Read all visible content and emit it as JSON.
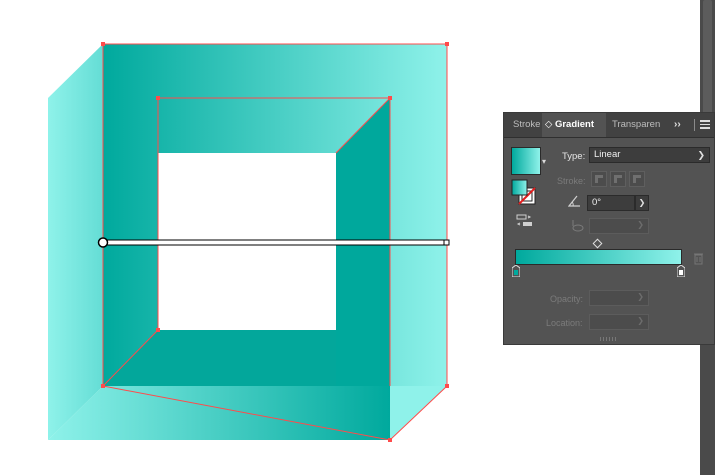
{
  "panel": {
    "tabs": [
      {
        "label": "Stroke",
        "active": false
      },
      {
        "label": "◇ Gradient",
        "active": true
      },
      {
        "label": "Transparen",
        "active": false
      }
    ],
    "overflow_label": "››",
    "type_label": "Type:",
    "type_value": "Linear",
    "stroke_label": "Stroke:",
    "angle_value": "0°",
    "opacity_label": "Opacity:",
    "location_label": "Location:"
  },
  "gradient": {
    "start_color": "#00a99d",
    "end_color": "#8ff2ea",
    "type": "linear",
    "angle_degrees": 0
  },
  "colors": {
    "panel_bg": "#535353",
    "tab_bar": "#424242",
    "selection": "#ff4b4b",
    "scrollbar": "#4a4a4a"
  },
  "icons": [
    "fill-stroke-icon",
    "angle-icon",
    "reverse-gradient-icon",
    "aspect-ratio-icon",
    "gradient-stop-icon",
    "trash-icon",
    "panel-menu-icon"
  ]
}
